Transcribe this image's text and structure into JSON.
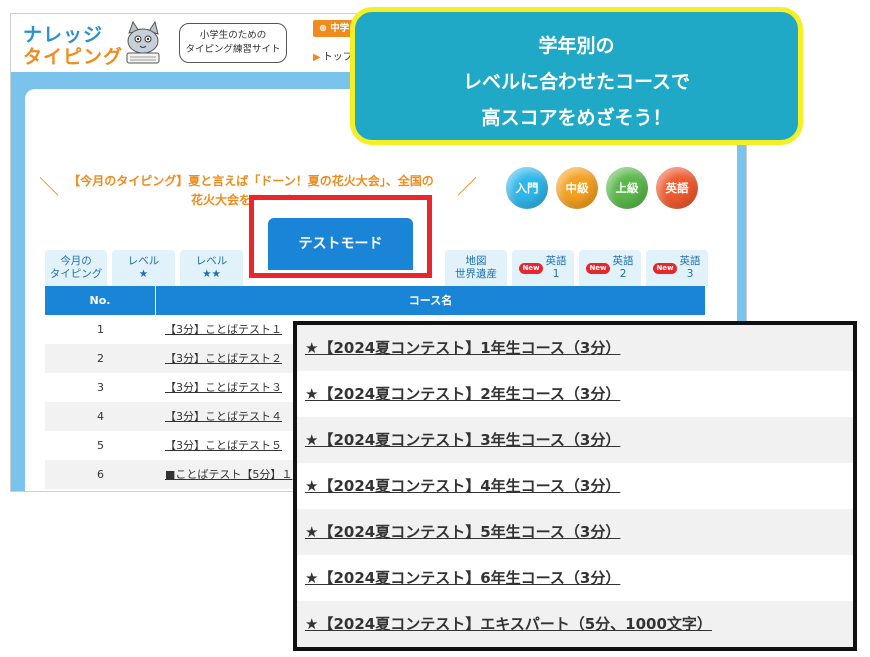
{
  "site": {
    "logo_line1": "ナレッジ",
    "logo_line2": "タイピング",
    "tagline_line1": "小学生のための",
    "tagline_line2": "タイピング練習サイト",
    "header_badge": "中学",
    "header_link": "トップ"
  },
  "callout": {
    "line1": "学年別の",
    "line2": "レベルに合わせたコースで",
    "line3": "高スコアをめざそう！"
  },
  "notice": {
    "line1": "【今月のタイピング】夏と言えば「ドーン！夏の花火大会」、全国の",
    "line2": "花火大会をテーマに…"
  },
  "levels": [
    {
      "label": "入門",
      "color": "#2fb6ea"
    },
    {
      "label": "中級",
      "color": "#f4a020"
    },
    {
      "label": "上級",
      "color": "#5ab84a"
    },
    {
      "label": "英語",
      "color": "#ef5a2f"
    }
  ],
  "tabs": [
    {
      "line1": "今月の",
      "line2": "タイピング"
    },
    {
      "line1": "レベル",
      "line2": "★"
    },
    {
      "line1": "レベル",
      "line2": "★★"
    },
    {
      "line1": "地図",
      "line2": "世界遺産"
    },
    {
      "badge": "New",
      "line1": "英語",
      "line2": "1"
    },
    {
      "badge": "New",
      "line1": "英語",
      "line2": "2"
    },
    {
      "badge": "New",
      "line1": "英語",
      "line2": "3"
    }
  ],
  "active_tab": "テストモード",
  "table": {
    "col_no": "No.",
    "col_name": "コース名",
    "rows": [
      {
        "no": "1",
        "name": "【3分】ことばテスト１"
      },
      {
        "no": "2",
        "name": "【3分】ことばテスト２"
      },
      {
        "no": "3",
        "name": "【3分】ことばテスト３"
      },
      {
        "no": "4",
        "name": "【3分】ことばテスト４"
      },
      {
        "no": "5",
        "name": "【3分】ことばテスト５"
      },
      {
        "no": "6",
        "name": "■ことばテスト【5分】１"
      }
    ]
  },
  "zoom_courses": [
    "★【2024夏コンテスト】1年生コース（3分）",
    "★【2024夏コンテスト】2年生コース（3分）",
    "★【2024夏コンテスト】3年生コース（3分）",
    "★【2024夏コンテスト】4年生コース（3分）",
    "★【2024夏コンテスト】5年生コース（3分）",
    "★【2024夏コンテスト】6年生コース（3分）",
    "★【2024夏コンテスト】エキスパート（5分、1000文字）"
  ],
  "colors": {
    "accent_blue": "#1a85d6",
    "orange": "#f08c1e",
    "highlight_red": "#e8262b",
    "callout_fill": "#20a9c6",
    "callout_border": "#f5ef26"
  }
}
